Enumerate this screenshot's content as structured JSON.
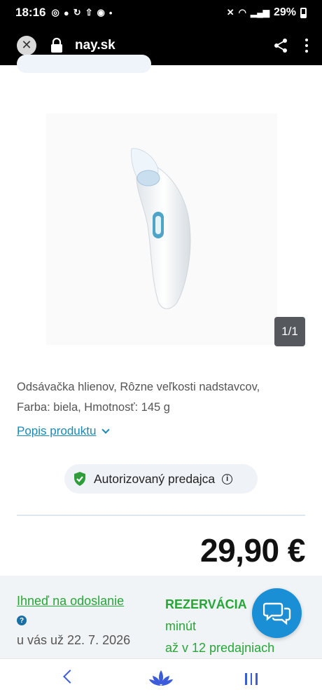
{
  "status_bar": {
    "time": "18:16",
    "battery": "29%"
  },
  "browser": {
    "url": "nay.sk"
  },
  "product": {
    "image_counter": "1/1",
    "description_line1": "Odsávačka hlienov, Rôzne veľkosti nadstavcov,",
    "description_line2": "Farba: biela, Hmotnosť: 145 g",
    "description_link": "Popis produktu",
    "authorized_badge": "Autorizovaný predajca",
    "price": "29,90 €"
  },
  "delivery": {
    "ship_link": "Ihneď na odoslanie",
    "ship_date": "u vás už 22. 7. 2026",
    "reservation_title": "REZERVÁCIA",
    "reservation_line2": "minút",
    "reservation_line3": "až v 12 predajniach"
  },
  "colors": {
    "accent_blue": "#1b89b3",
    "green": "#27a638",
    "chat": "#1a8fd6"
  },
  "icons": [
    "close-icon",
    "lock-icon",
    "share-icon",
    "more-vert-icon",
    "chevron-down-icon",
    "shield-check-icon",
    "info-icon",
    "help-icon",
    "chat-icon",
    "back-icon",
    "home-lotus-icon",
    "recent-apps-icon"
  ]
}
